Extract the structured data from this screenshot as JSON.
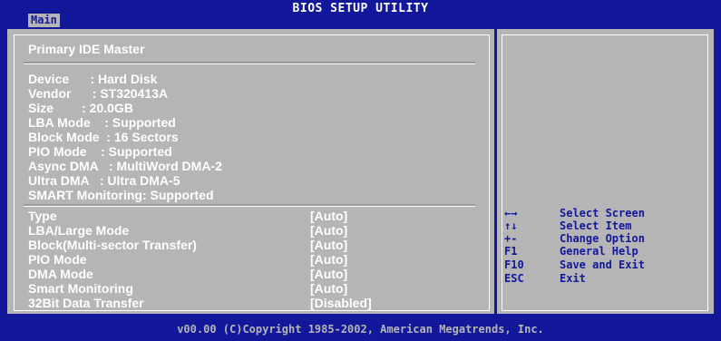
{
  "window": {
    "title": "BIOS SETUP UTILITY",
    "active_tab": "Main"
  },
  "device_info": {
    "heading": "Primary IDE Master",
    "lines": [
      "Device      : Hard Disk",
      "Vendor      : ST320413A",
      "Size        : 20.0GB",
      "LBA Mode    : Supported",
      "Block Mode  : 16 Sectors",
      "PIO Mode    : Supported",
      "Async DMA   : MultiWord DMA-2",
      "Ultra DMA   : Ultra DMA-5",
      "SMART Monitoring: Supported"
    ]
  },
  "settings": [
    {
      "label": "Type",
      "value": "[Auto]"
    },
    {
      "label": "LBA/Large Mode",
      "value": "[Auto]"
    },
    {
      "label": "Block(Multi-sector Transfer)",
      "value": "[Auto]"
    },
    {
      "label": "PIO Mode",
      "value": "[Auto]"
    },
    {
      "label": "DMA Mode",
      "value": "[Auto]"
    },
    {
      "label": "Smart Monitoring",
      "value": "[Auto]"
    },
    {
      "label": "32Bit Data Transfer",
      "value": "[Disabled]"
    }
  ],
  "help": [
    {
      "key": "←→",
      "desc": "Select Screen"
    },
    {
      "key": "↑↓",
      "desc": "Select Item"
    },
    {
      "key": "+-",
      "desc": "Change Option"
    },
    {
      "key": "F1",
      "desc": "General Help"
    },
    {
      "key": "F10",
      "desc": "Save and Exit"
    },
    {
      "key": "ESC",
      "desc": "Exit"
    }
  ],
  "footer": "v00.00 (C)Copyright 1985-2002, American Megatrends, Inc.",
  "colors": {
    "background": "#13189a",
    "panel": "#b5b5b5",
    "text_white": "#ffffff",
    "text_blue": "#13189a"
  }
}
